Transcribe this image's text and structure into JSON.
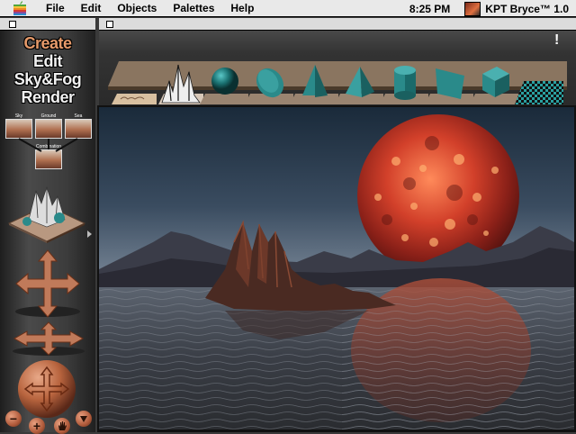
{
  "menubar": {
    "apple_icon": "apple-icon",
    "items": [
      "File",
      "Edit",
      "Objects",
      "Palettes",
      "Help"
    ],
    "clock": "8:25 PM",
    "app_name": "KPT Bryce™ 1.0"
  },
  "left_palette": {
    "modes": [
      "Create",
      "Edit",
      "Sky&Fog",
      "Render"
    ],
    "active_mode": "Create",
    "thumbnails": [
      "Sky",
      "Ground",
      "Sea",
      "Combination"
    ],
    "tools": [
      "minus-icon",
      "plus-icon",
      "hand-icon",
      "pointer-icon"
    ]
  },
  "object_palette": {
    "warning": "!",
    "objects": [
      "terrain-flat",
      "terrain-mountain",
      "sphere",
      "disc",
      "cone",
      "pyramid",
      "cylinder",
      "square-plane",
      "cube",
      "checker-plane"
    ]
  },
  "colors": {
    "accent": "#e69a6a",
    "object_teal": "#2a8a8a",
    "planet_red": "#c03020"
  }
}
